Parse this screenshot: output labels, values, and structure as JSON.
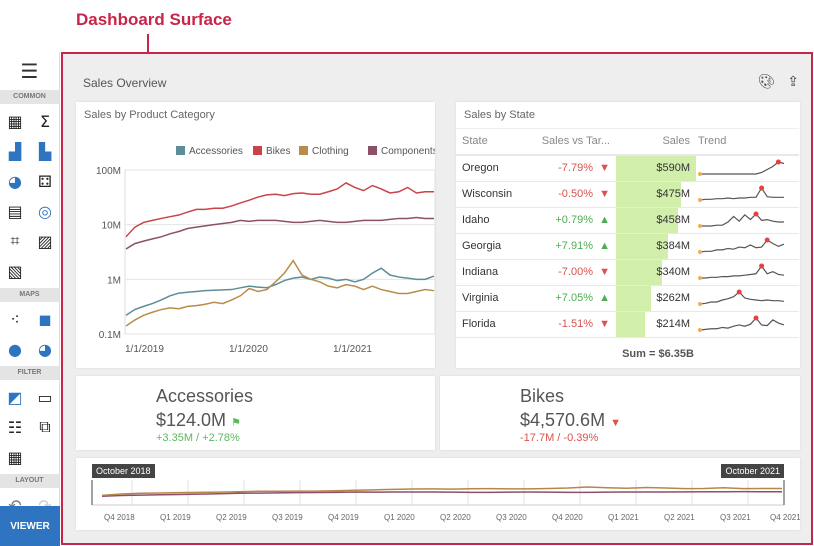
{
  "callout": "Dashboard Surface",
  "toolbox": {
    "sections": [
      "COMMON",
      "MAPS",
      "FILTER",
      "LAYOUT"
    ],
    "viewer": "VIEWER",
    "common_icons": [
      "grid-icon",
      "sum-icon",
      "bar-chart-icon",
      "treemap-icon",
      "pie-icon",
      "scatter-icon",
      "card-icon",
      "gauge-icon",
      "text-box-icon",
      "image-icon",
      "bound-image-icon"
    ],
    "map_icons": [
      "geo-point-map-icon",
      "choropleth-map-icon",
      "bubble-map-icon",
      "pie-map-icon"
    ],
    "filter_icons": [
      "range-filter-icon",
      "combo-box-icon",
      "list-box-icon",
      "tree-view-icon",
      "date-filter-icon"
    ]
  },
  "dashboard": {
    "title": "Sales Overview"
  },
  "chart_card": {
    "title": "Sales by Product Category"
  },
  "chart_data": {
    "type": "line",
    "title": "",
    "yscale": "log",
    "ylim": [
      0.1,
      100
    ],
    "yticks": [
      "0.1M",
      "1M",
      "10M",
      "100M"
    ],
    "xticks": [
      "1/1/2019",
      "1/1/2020",
      "1/1/2021"
    ],
    "x_start": "2019-01",
    "x_end": "2021-12",
    "legend": "top-right",
    "series": [
      {
        "name": "Accessories",
        "color": "#5b8e99",
        "values": [
          0.22,
          0.28,
          0.32,
          0.36,
          0.42,
          0.5,
          0.56,
          0.58,
          0.6,
          0.62,
          0.63,
          0.64,
          0.65,
          0.7,
          0.75,
          0.72,
          0.7,
          0.8,
          0.95,
          1.05,
          1.1,
          1.0,
          1.1,
          1.05,
          0.95,
          1.0,
          0.9,
          1.0,
          1.3,
          1.6,
          1.2,
          1.1,
          1.05,
          1.0,
          1.0,
          1.15
        ]
      },
      {
        "name": "Bikes",
        "color": "#c9434a",
        "values": [
          6,
          9,
          11,
          12,
          13,
          14,
          15,
          17,
          19,
          19,
          20,
          20,
          22,
          25,
          28,
          32,
          35,
          36,
          34,
          37,
          38,
          36,
          36,
          40,
          45,
          58,
          48,
          42,
          52,
          45,
          38,
          40,
          48,
          38,
          40,
          40
        ]
      },
      {
        "name": "Clothing",
        "color": "#b88c4a",
        "values": [
          0.14,
          0.18,
          0.22,
          0.25,
          0.28,
          0.3,
          0.29,
          0.32,
          0.33,
          0.35,
          0.38,
          0.36,
          0.42,
          0.5,
          0.68,
          0.6,
          0.65,
          0.9,
          1.3,
          2.2,
          1.2,
          1.0,
          0.9,
          0.75,
          0.7,
          0.8,
          0.75,
          0.65,
          0.75,
          0.65,
          0.6,
          0.55,
          0.55,
          0.6,
          0.65,
          0.62
        ]
      },
      {
        "name": "Components",
        "color": "#8c5068",
        "values": [
          3.6,
          4.5,
          5,
          5.5,
          6,
          6.8,
          7.5,
          8.5,
          9,
          9.5,
          10,
          10.5,
          11,
          12,
          11.5,
          12,
          12,
          12,
          11.5,
          11,
          11,
          11.5,
          12,
          11.5,
          11,
          11,
          11.5,
          12,
          12,
          12,
          12.5,
          13,
          13,
          13.5,
          13,
          13
        ]
      }
    ]
  },
  "state_card": {
    "title": "Sales by State",
    "columns": [
      "State",
      "Sales vs Tar...",
      "Sales",
      "Trend"
    ],
    "rows": [
      {
        "state": "Oregon",
        "delta": "-7.79%",
        "dir": "down",
        "sales": "$590M",
        "share": 1.0,
        "trend": [
          1,
          1,
          1,
          1,
          1,
          1,
          1,
          1,
          1,
          1,
          1,
          1.2,
          1.6,
          2,
          2.6,
          2.4
        ]
      },
      {
        "state": "Wisconsin",
        "delta": "-0.50%",
        "dir": "down",
        "sales": "$475M",
        "share": 0.81,
        "trend": [
          1,
          1.1,
          1.1,
          1.2,
          1.2,
          1.3,
          1.2,
          1.3,
          1.3,
          1.4,
          1.4,
          2.8,
          1.5,
          1.4,
          1.4,
          1.4
        ]
      },
      {
        "state": "Idaho",
        "delta": "+0.79%",
        "dir": "up",
        "sales": "$458M",
        "share": 0.78,
        "trend": [
          1,
          1,
          1,
          1.1,
          1.1,
          1.5,
          2.2,
          1.6,
          2.4,
          1.8,
          2.5,
          1.7,
          1.8,
          1.6,
          1.5,
          1.5
        ]
      },
      {
        "state": "Georgia",
        "delta": "+7.91%",
        "dir": "up",
        "sales": "$384M",
        "share": 0.65,
        "trend": [
          1,
          1.1,
          1.1,
          1.3,
          1.3,
          1.5,
          1.4,
          1.7,
          1.6,
          2,
          1.6,
          1.7,
          2.7,
          2.2,
          1.8,
          2.1
        ]
      },
      {
        "state": "Indiana",
        "delta": "-7.00%",
        "dir": "down",
        "sales": "$340M",
        "share": 0.58,
        "trend": [
          1,
          1,
          1.1,
          1.1,
          1.2,
          1.2,
          1.3,
          1.3,
          1.4,
          1.5,
          1.6,
          2.7,
          1.6,
          1.9,
          1.5,
          1.4
        ]
      },
      {
        "state": "Virginia",
        "delta": "+7.05%",
        "dir": "up",
        "sales": "$262M",
        "share": 0.44,
        "trend": [
          1,
          1.1,
          1.3,
          1.3,
          1.6,
          1.8,
          2.1,
          2.8,
          1.9,
          1.7,
          1.6,
          1.5,
          1.6,
          1.5,
          1.5,
          1.4
        ]
      },
      {
        "state": "Florida",
        "delta": "-1.51%",
        "dir": "down",
        "sales": "$214M",
        "share": 0.36,
        "trend": [
          1,
          1.1,
          1.2,
          1.2,
          1.4,
          1.3,
          1.6,
          1.8,
          1.6,
          1.9,
          2.9,
          1.8,
          1.7,
          2.6,
          2.1,
          1.8
        ]
      }
    ],
    "footer": "Sum = $6.35B"
  },
  "kpis": [
    {
      "name": "Accessories",
      "value": "$124.0M",
      "delta": "+3.35M / +2.78%",
      "status": "flag",
      "color": "#5cb85c"
    },
    {
      "name": "Bikes",
      "value": "$4,570.6M",
      "delta": "-17.7M / -0.39%",
      "status": "down",
      "color": "#d9534f"
    }
  ],
  "range": {
    "start": "October 2018",
    "end": "October 2021",
    "ticks": [
      "Q4 2018",
      "Q1 2019",
      "Q2 2019",
      "Q3 2019",
      "Q4 2019",
      "Q1 2020",
      "Q2 2020",
      "Q3 2020",
      "Q4 2020",
      "Q1 2021",
      "Q2 2021",
      "Q3 2021",
      "Q4 2021"
    ]
  }
}
